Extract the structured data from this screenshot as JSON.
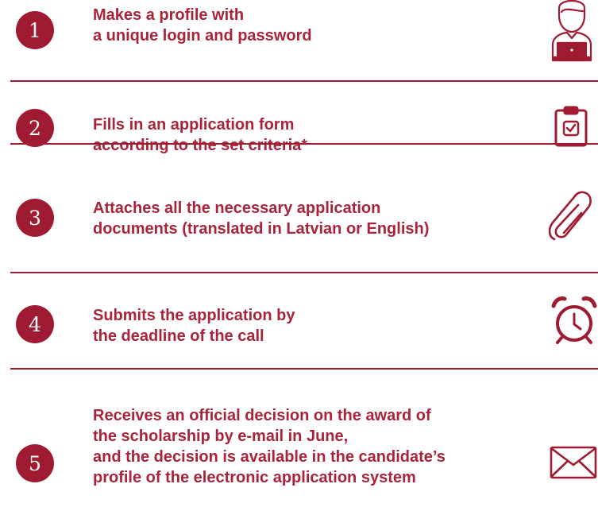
{
  "accent_color": "#9e1b32",
  "steps": [
    {
      "number": "1",
      "lines": [
        "Makes a profile with",
        "a unique login and password"
      ],
      "icon": "user-laptop-icon"
    },
    {
      "number": "2",
      "lines": [
        "Fills in an application form",
        "according to the set criteria*"
      ],
      "icon": "clipboard-check-icon"
    },
    {
      "number": "3",
      "lines": [
        "Attaches all the necessary application",
        "documents (translated in Latvian or English)"
      ],
      "icon": "paperclip-icon"
    },
    {
      "number": "4",
      "lines": [
        "Submits the application by",
        "the deadline of the call"
      ],
      "icon": "alarm-clock-icon"
    },
    {
      "number": "5",
      "lines": [
        "Receives an official decision on the award of",
        "the scholarship by e-mail in June,",
        "and the decision is available in the candidate’s",
        "profile of the electronic application system"
      ],
      "icon": "envelope-icon"
    }
  ]
}
